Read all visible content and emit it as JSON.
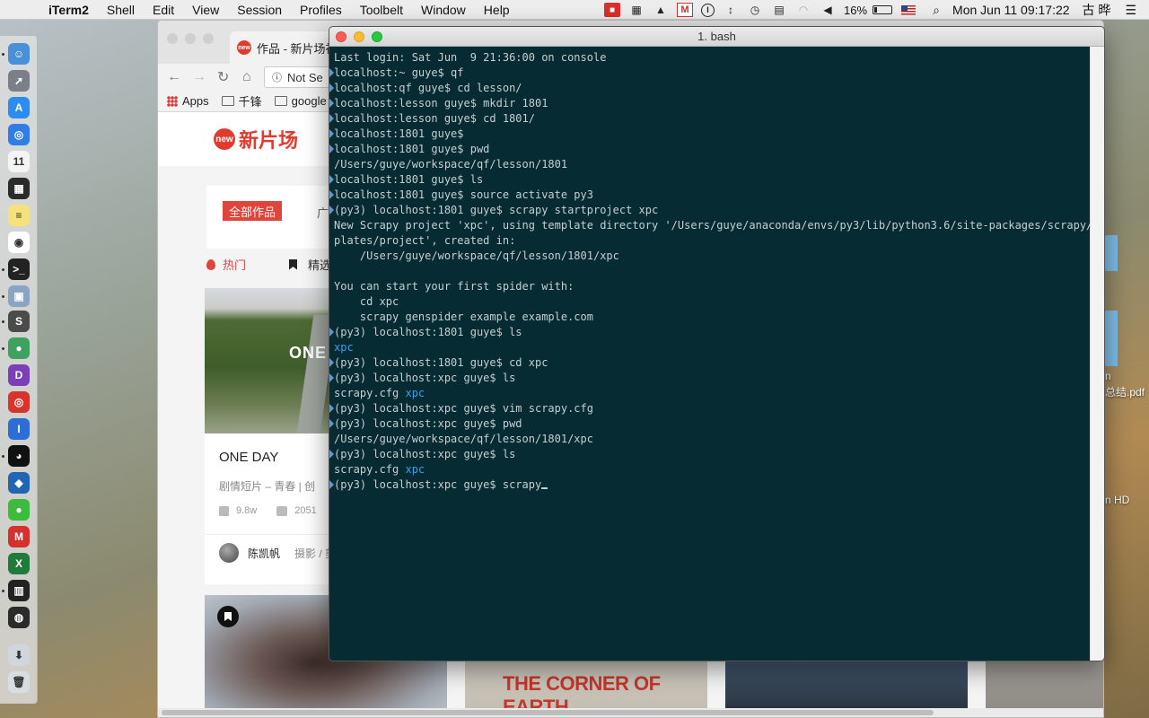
{
  "menubar": {
    "app_name": "iTerm2",
    "menus": [
      "Shell",
      "Edit",
      "View",
      "Session",
      "Profiles",
      "Toolbelt",
      "Window",
      "Help"
    ],
    "battery_percent": "16%",
    "clock": "Mon Jun 11  09:17:22",
    "user": "古 晔"
  },
  "browser": {
    "tab_title": "作品 - 新片场社",
    "omnibox_text": "Not Se",
    "bookmarks": [
      "Apps",
      "千锋",
      "google"
    ],
    "site": {
      "logo_badge": "new",
      "logo_name": "新片场",
      "all_works_button": "全部作品",
      "filter_more": "广",
      "tab_hot": "热门",
      "tab_picks": "精选",
      "card": {
        "overlay_text": "ONE",
        "title": "ONE DAY",
        "category": "剧情短片 – 青春   |   创",
        "views": "9.8w",
        "likes": "2051",
        "author": "陈凯帆",
        "role": "摄影 / 剪"
      },
      "thumb2_title": "THE CORNER OF EARTH"
    }
  },
  "desktop_labels": [
    "n",
    "总结.pdf",
    "n HD"
  ],
  "terminal": {
    "title": "1. bash",
    "lines": [
      {
        "text": "Last login: Sat Jun  9 21:36:00 on console",
        "mark": false
      },
      {
        "text": "localhost:~ guye$ qf",
        "mark": true
      },
      {
        "text": "localhost:qf guye$ cd lesson/",
        "mark": true
      },
      {
        "text": "localhost:lesson guye$ mkdir 1801",
        "mark": true
      },
      {
        "text": "localhost:lesson guye$ cd 1801/",
        "mark": true
      },
      {
        "text": "localhost:1801 guye$",
        "mark": true
      },
      {
        "text": "localhost:1801 guye$ pwd",
        "mark": true
      },
      {
        "text": "/Users/guye/workspace/qf/lesson/1801",
        "mark": false
      },
      {
        "text": "localhost:1801 guye$ ls",
        "mark": true
      },
      {
        "text": "localhost:1801 guye$ source activate py3",
        "mark": true
      },
      {
        "text": "(py3) localhost:1801 guye$ scrapy startproject xpc",
        "mark": true
      },
      {
        "text": "New Scrapy project 'xpc', using template directory '/Users/guye/anaconda/envs/py3/lib/python3.6/site-packages/scrapy/tem",
        "mark": false
      },
      {
        "text": "plates/project', created in:",
        "mark": false
      },
      {
        "text": "    /Users/guye/workspace/qf/lesson/1801/xpc",
        "mark": false
      },
      {
        "text": "",
        "mark": false
      },
      {
        "text": "You can start your first spider with:",
        "mark": false
      },
      {
        "text": "    cd xpc",
        "mark": false
      },
      {
        "text": "    scrapy genspider example example.com",
        "mark": false
      },
      {
        "text": "(py3) localhost:1801 guye$ ls",
        "mark": true
      },
      {
        "text": "",
        "blue": "xpc",
        "mark": false
      },
      {
        "text": "(py3) localhost:1801 guye$ cd xpc",
        "mark": true
      },
      {
        "text": "(py3) localhost:xpc guye$ ls",
        "mark": true
      },
      {
        "text": "scrapy.cfg ",
        "blue": "xpc",
        "mark": false
      },
      {
        "text": "(py3) localhost:xpc guye$ vim scrapy.cfg",
        "mark": true
      },
      {
        "text": "(py3) localhost:xpc guye$ pwd",
        "mark": true
      },
      {
        "text": "/Users/guye/workspace/qf/lesson/1801/xpc",
        "mark": false
      },
      {
        "text": "(py3) localhost:xpc guye$ ls",
        "mark": true
      },
      {
        "text": "scrapy.cfg ",
        "blue": "xpc",
        "mark": false
      },
      {
        "text": "(py3) localhost:xpc guye$ scrapy",
        "mark": true,
        "cursor": true
      }
    ]
  },
  "colors": {
    "terminal_bg": "#062b33",
    "terminal_fg": "#c6cfd1",
    "terminal_dir": "#3e9ee6",
    "brand_red": "#e23b2e"
  },
  "dock_icons": [
    "finder-icon",
    "launchpad-icon",
    "app-store-icon",
    "safari-icon",
    "calendar-icon",
    "mission-control-icon",
    "notes-icon",
    "chrome-icon",
    "terminal-icon",
    "preview-icon",
    "sublime-text-icon",
    "pycharm-icon",
    "dash-icon",
    "netease-music-icon",
    "onepassword-icon",
    "qq-icon",
    "vscode-icon",
    "wechat-icon",
    "mweb-icon",
    "excel-icon",
    "activity-monitor-icon",
    "obs-icon",
    "downloads-icon",
    "trash-icon"
  ]
}
